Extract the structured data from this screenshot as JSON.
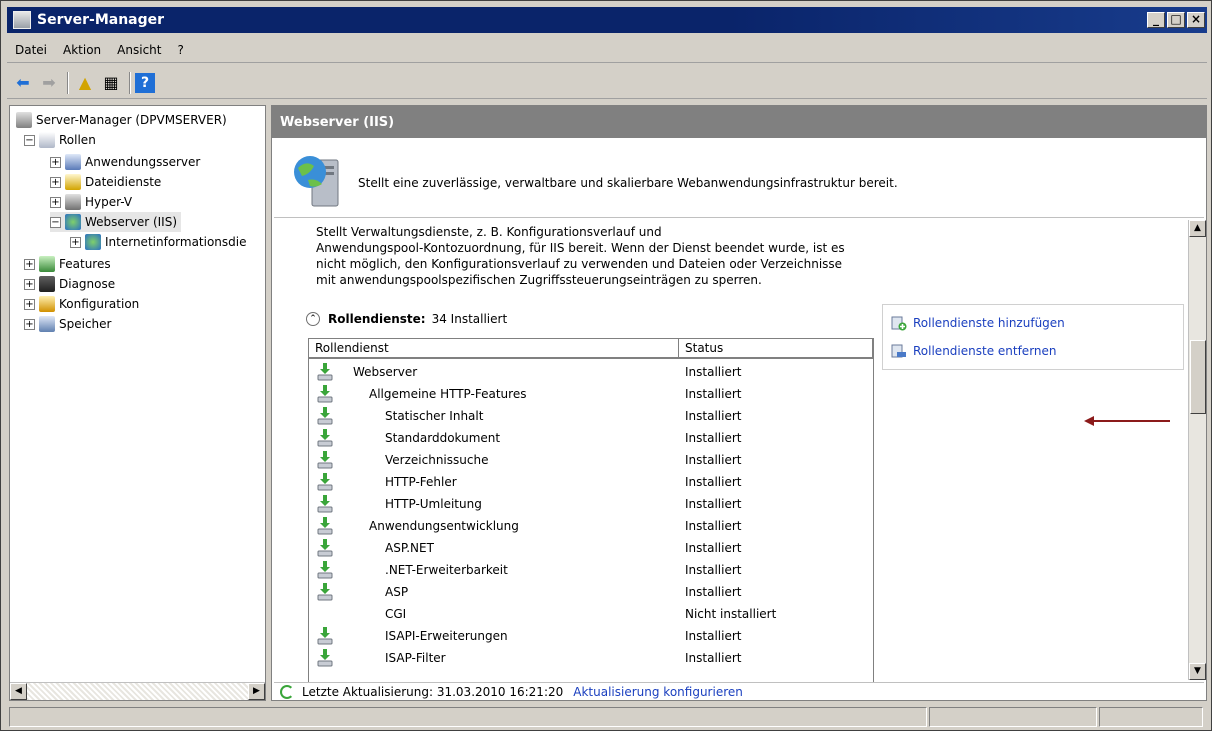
{
  "window": {
    "title": "Server-Manager"
  },
  "menu": [
    "Datei",
    "Aktion",
    "Ansicht",
    "?"
  ],
  "tree": {
    "root": "Server-Manager (DPVMSERVER)",
    "items": [
      {
        "label": "Rollen",
        "level": 1,
        "expander": "−"
      },
      {
        "label": "Anwendungsserver",
        "level": 2,
        "expander": "+"
      },
      {
        "label": "Dateidienste",
        "level": 2,
        "expander": "+"
      },
      {
        "label": "Hyper-V",
        "level": 2,
        "expander": "+"
      },
      {
        "label": "Webserver (IIS)",
        "level": 2,
        "expander": "−",
        "selected": true
      },
      {
        "label": "Internetinformationsdie",
        "level": 3,
        "expander": "+"
      },
      {
        "label": "Features",
        "level": 1,
        "expander": "+"
      },
      {
        "label": "Diagnose",
        "level": 1,
        "expander": "+"
      },
      {
        "label": "Konfiguration",
        "level": 1,
        "expander": "+"
      },
      {
        "label": "Speicher",
        "level": 1,
        "expander": "+"
      }
    ]
  },
  "main": {
    "header": "Webserver (IIS)",
    "banner_text": "Stellt eine zuverlässige, verwaltbare und skalierbare Webanwendungsinfrastruktur bereit.",
    "description": [
      "Stellt Verwaltungsdienste, z. B. Konfigurationsverlauf und",
      "Anwendungspool-Kontozuordnung, für IIS bereit. Wenn der Dienst beendet wurde, ist es",
      "nicht möglich, den Konfigurationsverlauf zu verwenden und Dateien oder Verzeichnisse",
      "mit anwendungspoolspezifischen Zugriffssteuerungseinträgen zu sperren."
    ],
    "role_services_title": "Rollendienste:",
    "role_services_count": "34 Installiert",
    "columns": [
      "Rollendienst",
      "Status"
    ],
    "rows": [
      {
        "name": "Webserver",
        "indent": 0,
        "status": "Installiert",
        "icon": true
      },
      {
        "name": "Allgemeine HTTP-Features",
        "indent": 1,
        "status": "Installiert",
        "icon": true
      },
      {
        "name": "Statischer Inhalt",
        "indent": 2,
        "status": "Installiert",
        "icon": true
      },
      {
        "name": "Standarddokument",
        "indent": 2,
        "status": "Installiert",
        "icon": true
      },
      {
        "name": "Verzeichnissuche",
        "indent": 2,
        "status": "Installiert",
        "icon": true
      },
      {
        "name": "HTTP-Fehler",
        "indent": 2,
        "status": "Installiert",
        "icon": true
      },
      {
        "name": "HTTP-Umleitung",
        "indent": 2,
        "status": "Installiert",
        "icon": true
      },
      {
        "name": "Anwendungsentwicklung",
        "indent": 1,
        "status": "Installiert",
        "icon": true
      },
      {
        "name": "ASP.NET",
        "indent": 2,
        "status": "Installiert",
        "icon": true
      },
      {
        "name": ".NET-Erweiterbarkeit",
        "indent": 2,
        "status": "Installiert",
        "icon": true
      },
      {
        "name": "ASP",
        "indent": 2,
        "status": "Installiert",
        "icon": true
      },
      {
        "name": "CGI",
        "indent": 2,
        "status": "Nicht installiert",
        "icon": false
      },
      {
        "name": "ISAPI-Erweiterungen",
        "indent": 2,
        "status": "Installiert",
        "icon": true
      },
      {
        "name": "ISAP-Filter",
        "indent": 2,
        "status": "Installiert",
        "icon": true
      }
    ],
    "actions": {
      "add": "Rollendienste hinzufügen",
      "remove": "Rollendienste entfernen"
    },
    "footer": {
      "last_update": "Letzte Aktualisierung: 31.03.2010 16:21:20",
      "configure_link": "Aktualisierung konfigurieren"
    }
  },
  "colors": {
    "titlebar": "#0a246a",
    "header": "#808080",
    "link": "#1a3fbf",
    "annotation_arrow": "#8b1a1a"
  }
}
